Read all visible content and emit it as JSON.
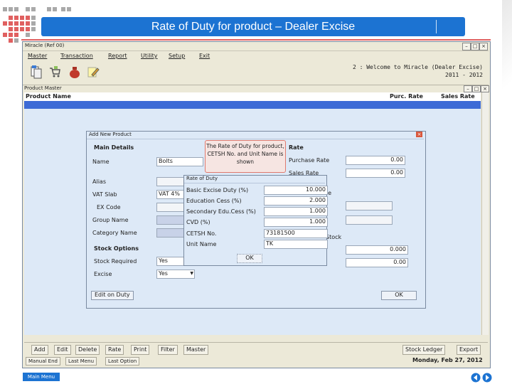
{
  "slide": {
    "title": "Rate of Duty for product – Dealer Excise",
    "main_menu_label": "Main Menu"
  },
  "app": {
    "window_title": "Miracle (Ref 00)",
    "menu": [
      "Master",
      "Transaction",
      "Report",
      "Utility",
      "Setup",
      "Exit"
    ],
    "welcome_line1": "2 : Welcome to Miracle (Dealer Excise)",
    "welcome_line2": "2011 - 2012",
    "toolbar_icons": [
      "documents-icon",
      "cart-icon",
      "money-bag-icon",
      "pencil-note-icon"
    ]
  },
  "product_master": {
    "window_title": "Product Master",
    "col_name": "Product Name",
    "col_purc": "Purc. Rate",
    "col_sales": "Sales Rate",
    "bottom_buttons": [
      "Add",
      "Edit",
      "Delete",
      "Rate",
      "Print",
      "Filter",
      "Master"
    ],
    "right_buttons": [
      "Stock Ledger",
      "Export"
    ],
    "status_buttons": [
      "Manual End",
      "Last Menu",
      "Last Option"
    ],
    "date": "Monday, Feb 27, 2012"
  },
  "add_product": {
    "title": "Add New Product",
    "main_details": "Main Details",
    "name_label": "Name",
    "name_value": "Bolts",
    "alias_label": "Alias",
    "vat_slab_label": "VAT Slab",
    "vat_slab_value": "VAT 4%",
    "excise_code_label": "EX Code",
    "group_name_label": "Group Name",
    "category_name_label": "Category Name",
    "stock_options": "Stock Options",
    "stock_required_label": "Stock Required",
    "stock_required_value": "Yes",
    "excise_label": "Excise",
    "excise_value": "Yes",
    "rate_group": "Rate",
    "purchase_rate_label": "Purchase Rate",
    "purchase_rate_value": "0.00",
    "sales_rate_label": "Sales Rate",
    "sales_rate_value": "0.00",
    "opening_stock_value": "0.000",
    "stock_value": "0.00",
    "stock_label": "Stock",
    "rate_label_short": "te",
    "edit_on_duty_button": "Edit on Duty",
    "ok_button": "OK"
  },
  "rate_of_duty": {
    "title": "Rate of Duty",
    "rows": [
      {
        "label": "Basic Excise Duty (%)",
        "value": "10.000"
      },
      {
        "label": "Education Cess (%)",
        "value": "2.000"
      },
      {
        "label": "Secondary Edu.Cess (%)",
        "value": "1.000"
      },
      {
        "label": "CVD (%)",
        "value": "1.000"
      }
    ],
    "cetsh_label": "CETSH No.",
    "cetsh_value": "73181500",
    "unit_label": "Unit Name",
    "unit_value": "TK",
    "ok_button": "OK"
  },
  "callout": {
    "text": "The Rate of Duty for product, CETSH No. and Unit Name is shown"
  },
  "colors": {
    "banner_blue": "#1c73d2",
    "accent_red": "#e06060",
    "selection_blue": "#3d6bd6",
    "panel_blue": "#dde9f7"
  }
}
